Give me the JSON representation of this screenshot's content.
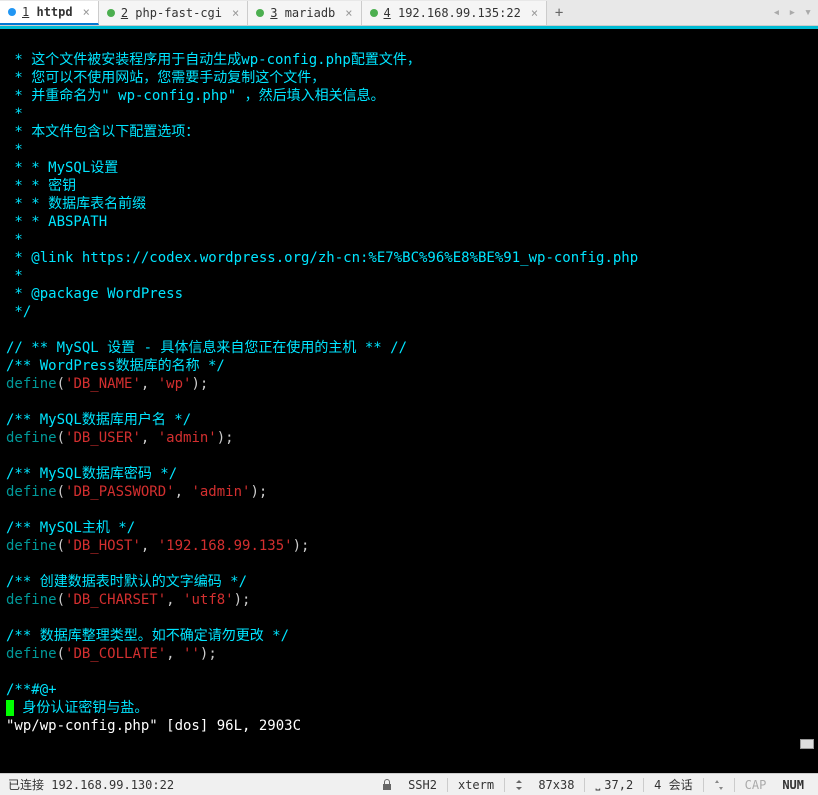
{
  "tabs": [
    {
      "num": "1",
      "label": "httpd",
      "active": true
    },
    {
      "num": "2",
      "label": "php-fast-cgi",
      "active": false
    },
    {
      "num": "3",
      "label": "mariadb",
      "active": false
    },
    {
      "num": "4",
      "label": "192.168.99.135:22",
      "active": false
    }
  ],
  "code": {
    "c1": " * 这个文件被安装程序用于自动生成wp-config.php配置文件，",
    "c2": " * 您可以不使用网站，您需要手动复制这个文件，",
    "c3": " * 并重命名为\" wp-config.php\" ，然后填入相关信息。",
    "c4": " *",
    "c5": " * 本文件包含以下配置选项：",
    "c6": " *",
    "c7": " * * MySQL设置",
    "c8": " * * 密钥",
    "c9": " * * 数据库表名前缀",
    "c10": " * * ABSPATH",
    "c11": " *",
    "c12": " * @link https://codex.wordpress.org/zh-cn:%E7%BC%96%E8%BE%91_wp-config.php",
    "c13": " *",
    "c14": " * @package WordPress",
    "c15": " */",
    "blank": "",
    "m1": "// ** MySQL 设置 - 具体信息来自您正在使用的主机 ** //",
    "m2": "/** WordPress数据库的名称 */",
    "def": "define",
    "p_open": "(",
    "p_close": ");",
    "comma": ", ",
    "q1": "'DB_NAME'",
    "v1": "'wp'",
    "m3": "/** MySQL数据库用户名 */",
    "q2": "'DB_USER'",
    "v2": "'admin'",
    "m4": "/** MySQL数据库密码 */",
    "q3": "'DB_PASSWORD'",
    "v3": "'admin'",
    "m5": "/** MySQL主机 */",
    "q4": "'DB_HOST'",
    "v4": "'192.168.99.135'",
    "m6": "/** 创建数据表时默认的文字编码 */",
    "q5": "'DB_CHARSET'",
    "v5": "'utf8'",
    "m7": "/** 数据库整理类型。如不确定请勿更改 */",
    "q6": "'DB_COLLATE'",
    "v6": "''",
    "a1": "/**#@+",
    "a2": " 身份认证密钥与盐。",
    "status": "\"wp/wp-config.php\" [dos] 96L, 2903C"
  },
  "statusbar": {
    "connected": "已连接 192.168.99.130:22",
    "ssh": "SSH2",
    "term": "xterm",
    "size": "87x38",
    "pos": "37,2",
    "sessions": "4 会话",
    "cap": "CAP",
    "num": "NUM"
  }
}
